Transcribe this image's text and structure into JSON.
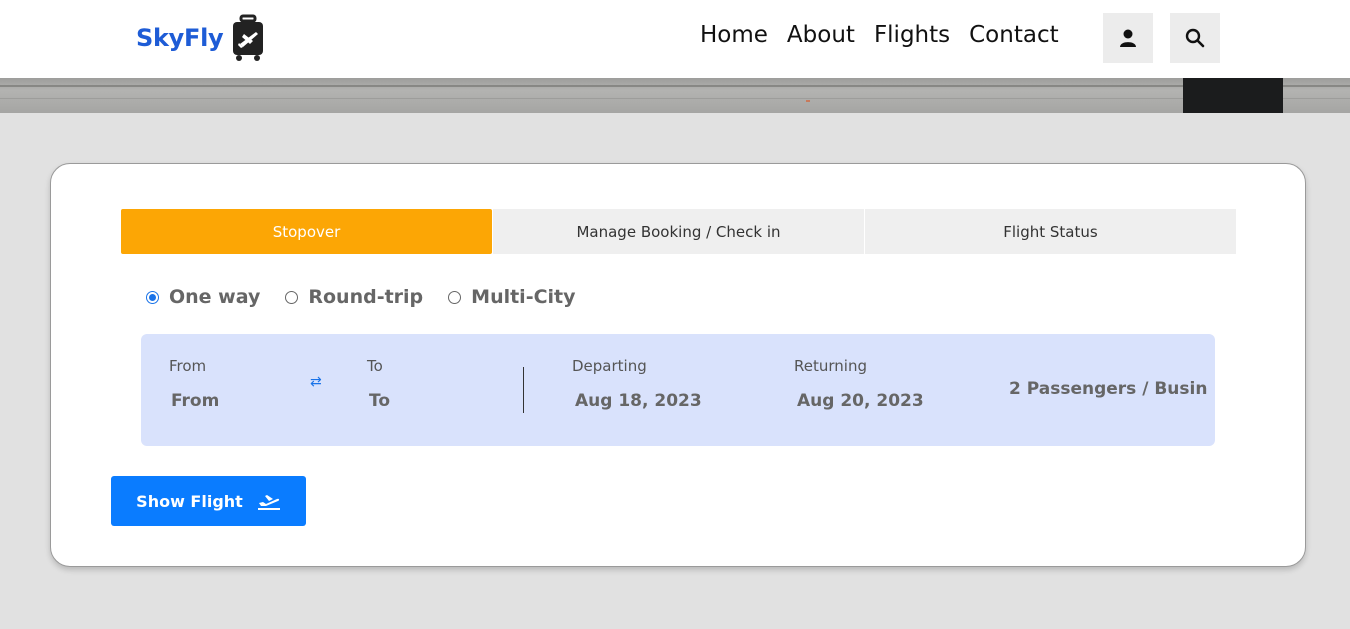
{
  "brand": {
    "name": "SkyFly",
    "logo_icon": "luggage-plane-icon"
  },
  "nav": {
    "links": [
      "Home",
      "About",
      "Flights",
      "Contact"
    ],
    "user_icon": "user-icon",
    "search_icon": "search-icon"
  },
  "tabs": [
    {
      "label": "Stopover",
      "active": true
    },
    {
      "label": "Manage Booking / Check in",
      "active": false
    },
    {
      "label": "Flight Status",
      "active": false
    }
  ],
  "trip_types": [
    {
      "label": "One way",
      "checked": true
    },
    {
      "label": "Round-trip",
      "checked": false
    },
    {
      "label": "Multi-City",
      "checked": false
    }
  ],
  "search": {
    "from": {
      "label": "From",
      "value": "From"
    },
    "to": {
      "label": "To",
      "value": "To"
    },
    "swap_icon": "swap-arrows-icon",
    "departing": {
      "label": "Departing",
      "value": "Aug 18, 2023"
    },
    "returning": {
      "label": "Returning",
      "value": "Aug 20, 2023"
    },
    "passengers": "2 Passengers / Busin"
  },
  "show_button": {
    "label": "Show Flight",
    "icon": "plane-departure-icon"
  },
  "colors": {
    "brand_blue": "#1e5cd6",
    "tab_active": "#fca605",
    "panel_bg": "#d9e2fc",
    "button_blue": "#0a7cff",
    "page_bg": "#e1e1e1"
  }
}
